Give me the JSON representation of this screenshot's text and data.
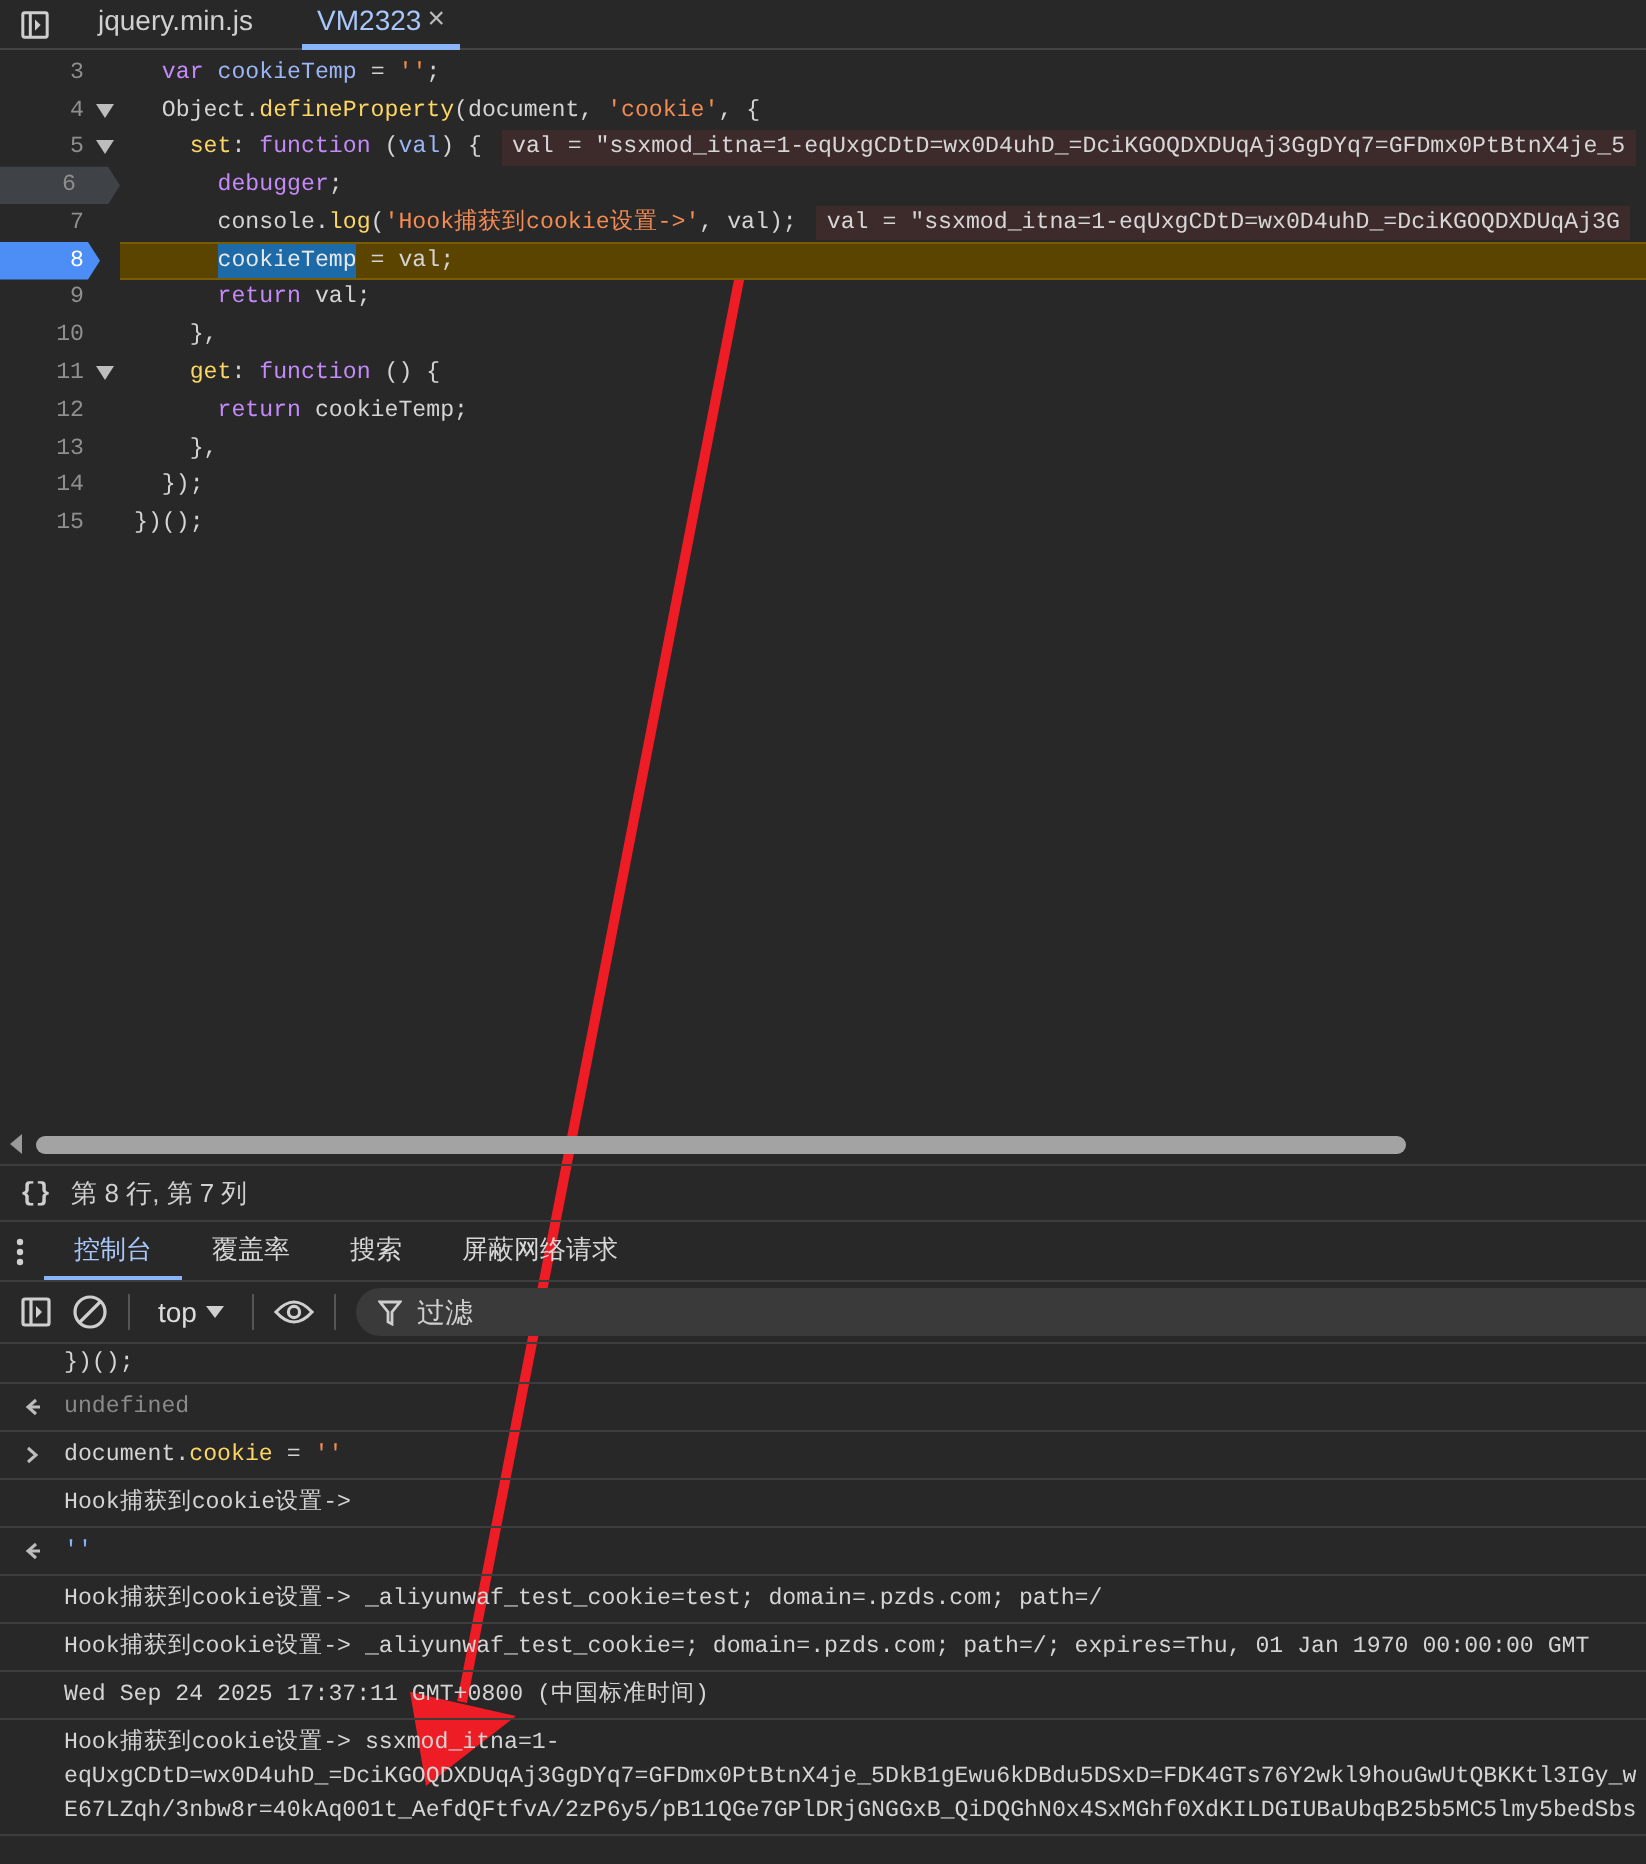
{
  "tabs": [
    {
      "label": "jquery.min.js",
      "selected": false
    },
    {
      "label": "VM2323",
      "selected": true,
      "close": "×"
    }
  ],
  "code": {
    "lines": [
      {
        "number": "3",
        "foldable": false,
        "breakpoint": false,
        "current": false,
        "tokens": [
          {
            "kind": "keyword",
            "text": "  var"
          },
          {
            "kind": "variable",
            "text": " cookieTemp"
          },
          {
            "kind": "plain",
            "text": " = "
          },
          {
            "kind": "string",
            "text": "''"
          },
          {
            "kind": "plain",
            "text": ";"
          }
        ]
      },
      {
        "number": "4",
        "foldable": true,
        "breakpoint": false,
        "current": false,
        "tokens": [
          {
            "kind": "plain",
            "text": "  Object."
          },
          {
            "kind": "property",
            "text": "defineProperty"
          },
          {
            "kind": "plain",
            "text": "(document, "
          },
          {
            "kind": "string",
            "text": "'cookie'"
          },
          {
            "kind": "plain",
            "text": ", {"
          }
        ]
      },
      {
        "number": "5",
        "foldable": true,
        "breakpoint": false,
        "current": false,
        "tokens": [
          {
            "kind": "property",
            "text": "    set"
          },
          {
            "kind": "plain",
            "text": ": "
          },
          {
            "kind": "keyword",
            "text": "function"
          },
          {
            "kind": "plain",
            "text": " ("
          },
          {
            "kind": "variable",
            "text": "val"
          },
          {
            "kind": "plain",
            "text": ") {"
          }
        ],
        "inline_value": "val = \"ssxmod_itna=1-eqUxgCDtD=wx0D4uhD_=DciKGOQDXDUqAj3GgDYq7=GFDmx0PtBtnX4je_5"
      },
      {
        "number": "6",
        "foldable": false,
        "breakpoint": true,
        "breakpoint_enabled": false,
        "current": false,
        "tokens": [
          {
            "kind": "keyword",
            "text": "      debugger"
          },
          {
            "kind": "plain",
            "text": ";"
          }
        ]
      },
      {
        "number": "7",
        "foldable": false,
        "breakpoint": false,
        "current": false,
        "tokens": [
          {
            "kind": "plain",
            "text": "      console."
          },
          {
            "kind": "property",
            "text": "log"
          },
          {
            "kind": "plain",
            "text": "("
          },
          {
            "kind": "string",
            "text": "'Hook捕获到cookie设置->'"
          },
          {
            "kind": "plain",
            "text": ", val);"
          }
        ],
        "inline_value": "val = \"ssxmod_itna=1-eqUxgCDtD=wx0D4uhD_=DciKGOQDXDUqAj3G"
      },
      {
        "number": "8",
        "foldable": false,
        "breakpoint": true,
        "breakpoint_enabled": true,
        "current": true,
        "tokens": [
          {
            "kind": "selection",
            "text": "      cookieTemp"
          },
          {
            "kind": "plain",
            "text": " = val;"
          }
        ]
      },
      {
        "number": "9",
        "foldable": false,
        "breakpoint": false,
        "current": false,
        "tokens": [
          {
            "kind": "keyword",
            "text": "      return"
          },
          {
            "kind": "plain",
            "text": " val;"
          }
        ]
      },
      {
        "number": "10",
        "foldable": false,
        "breakpoint": false,
        "current": false,
        "tokens": [
          {
            "kind": "plain",
            "text": "    },"
          }
        ]
      },
      {
        "number": "11",
        "foldable": true,
        "breakpoint": false,
        "current": false,
        "tokens": [
          {
            "kind": "property",
            "text": "    get"
          },
          {
            "kind": "plain",
            "text": ": "
          },
          {
            "kind": "keyword",
            "text": "function"
          },
          {
            "kind": "plain",
            "text": " () {"
          }
        ]
      },
      {
        "number": "12",
        "foldable": false,
        "breakpoint": false,
        "current": false,
        "tokens": [
          {
            "kind": "keyword",
            "text": "      return"
          },
          {
            "kind": "plain",
            "text": " cookieTemp;"
          }
        ]
      },
      {
        "number": "13",
        "foldable": false,
        "breakpoint": false,
        "current": false,
        "tokens": [
          {
            "kind": "plain",
            "text": "    },"
          }
        ]
      },
      {
        "number": "14",
        "foldable": false,
        "breakpoint": false,
        "current": false,
        "tokens": [
          {
            "kind": "plain",
            "text": "  });"
          }
        ]
      },
      {
        "number": "15",
        "foldable": false,
        "breakpoint": false,
        "current": false,
        "tokens": [
          {
            "kind": "plain",
            "text": "})();"
          }
        ]
      }
    ]
  },
  "status_bar": {
    "braces": "{}",
    "position": "第 8 行, 第 7 列"
  },
  "drawer_tabs": [
    {
      "label": "控制台",
      "selected": true
    },
    {
      "label": "覆盖率",
      "selected": false
    },
    {
      "label": "搜索",
      "selected": false
    },
    {
      "label": "屏蔽网络请求",
      "selected": false
    }
  ],
  "console_toolbar": {
    "context": "top",
    "filter_placeholder": "过滤"
  },
  "messages": [
    {
      "kind": "plain",
      "tokens": [
        {
          "kind": "plain",
          "text": "})();"
        }
      ]
    },
    {
      "kind": "result",
      "tokens": [
        {
          "kind": "undefined",
          "text": "undefined"
        }
      ]
    },
    {
      "kind": "input",
      "tokens": [
        {
          "kind": "plain",
          "text": "document."
        },
        {
          "kind": "property",
          "text": "cookie"
        },
        {
          "kind": "plain",
          "text": " = "
        },
        {
          "kind": "string",
          "text": "''"
        }
      ]
    },
    {
      "kind": "plain",
      "tokens": [
        {
          "kind": "plain",
          "text": "Hook捕获到cookie设置->"
        }
      ]
    },
    {
      "kind": "result",
      "tokens": [
        {
          "kind": "value",
          "text": "''"
        }
      ]
    },
    {
      "kind": "plain",
      "tokens": [
        {
          "kind": "plain",
          "text": "Hook捕获到cookie设置-> _aliyunwaf_test_cookie=test; domain=.pzds.com; path=/"
        }
      ]
    },
    {
      "kind": "plain",
      "tokens": [
        {
          "kind": "plain",
          "text": "Hook捕获到cookie设置-> _aliyunwaf_test_cookie=; domain=.pzds.com; path=/; expires=Thu, 01 Jan 1970 00:00:00 GMT"
        }
      ]
    },
    {
      "kind": "plain",
      "tokens": [
        {
          "kind": "plain",
          "text": "Wed Sep 24 2025 17:37:11 GMT+0800 (中国标准时间)"
        }
      ]
    },
    {
      "kind": "multiline",
      "lines": [
        "Hook捕获到cookie设置-> ssxmod_itna=1-",
        "eqUxgCDtD=wx0D4uhD_=DciKGOQDXDUqAj3GgDYq7=GFDmx0PtBtnX4je_5DkB1gEwu6kDBdu5DSxD=FDK4GTs76Y2wkl9houGwUtQBKKtl3IGy_w",
        "E67LZqh/3nbw8r=40kAq001t_AefdQFtfvA/2zP6y5/pB11QGe7GPlDRjGNGGxB_QiDQGhN0x4SxMGhf0XdKILDGIUBaUbqB25b5MC5lmy5bedSbs"
      ]
    }
  ]
}
